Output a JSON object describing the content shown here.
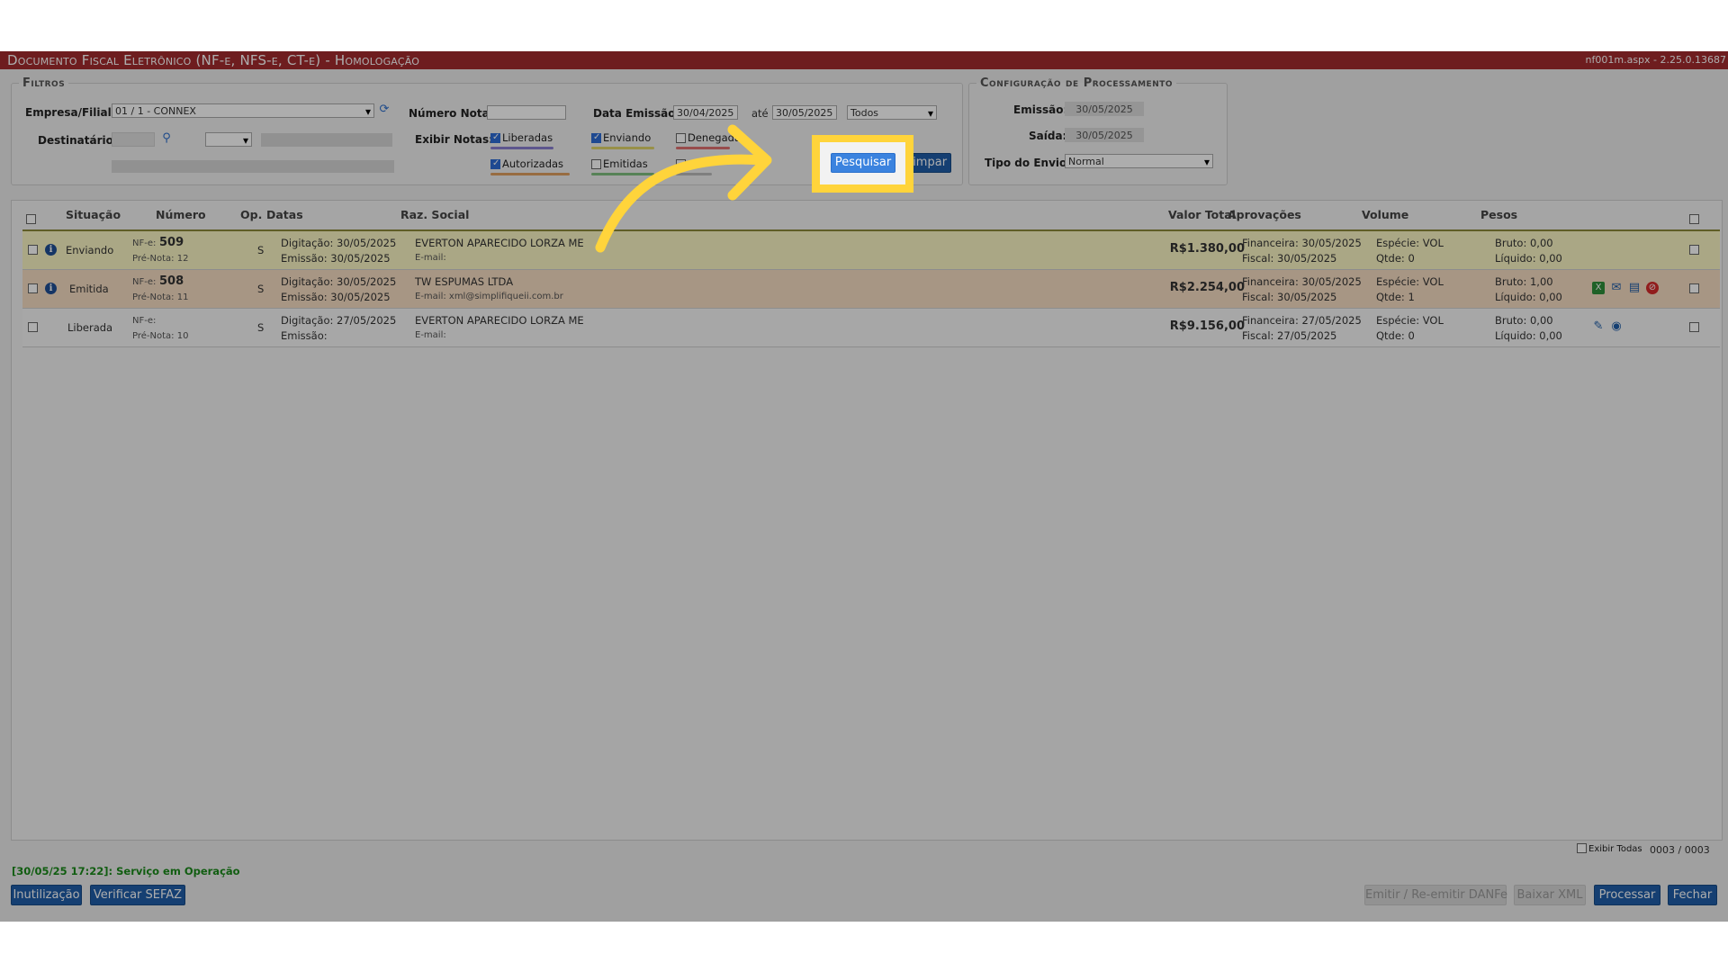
{
  "window": {
    "title": "Documento Fiscal Eletrônico (NF-e, NFS-e, CT-e) - Homologação",
    "version": "nf001m.aspx - 2.25.0.13687"
  },
  "filters": {
    "legend": "Filtros",
    "empresa_label": "Empresa/Filial:",
    "empresa_value": "01 / 1 - CONNEX",
    "destinatario_label": "Destinatário:",
    "numero_nota_label": "Número Nota:",
    "numero_nota_value": "",
    "data_emissao_label": "Data Emissão:",
    "data_de": "30/04/2025",
    "ate_label": "até",
    "data_ate": "30/05/2025",
    "periodo_value": "Todos",
    "exibir_label": "Exibir Notas:",
    "checks": [
      {
        "label": "Liberadas",
        "checked": true,
        "color": "#8a7fd0"
      },
      {
        "label": "Enviando",
        "checked": true,
        "color": "#e0d56a"
      },
      {
        "label": "Denegadas",
        "checked": false,
        "color": "#e07070"
      },
      {
        "label": "Autorizadas",
        "checked": true,
        "color": "#e0a060"
      },
      {
        "label": "Emitidas",
        "checked": false,
        "color": "#80c080"
      },
      {
        "label": "",
        "checked": false,
        "color": "#bbbbbb"
      }
    ],
    "search_button": "Pesquisar",
    "clear_button": "Limpar"
  },
  "config": {
    "legend": "Configuração de Processamento",
    "emissao_label": "Emissão:",
    "emissao_value": "30/05/2025",
    "saida_label": "Saída:",
    "saida_value": "30/05/2025",
    "tipo_label": "Tipo do Envio:",
    "tipo_value": "Normal"
  },
  "table": {
    "headers": [
      "Situação",
      "Número",
      "Op.",
      "Datas",
      "Raz. Social",
      "Valor Total",
      "Aprovações",
      "Volume",
      "Pesos"
    ],
    "rows": [
      {
        "situacao": "Enviando",
        "nfe_label": "NF-e:",
        "nfe": "509",
        "prenota": "Pré-Nota: 12",
        "op": "S",
        "digitacao": "Digitação: 30/05/2025",
        "emissao": "Emissão: 30/05/2025",
        "razao": "EVERTON APARECIDO LORZA ME",
        "email": "E-mail:",
        "valor": "R$1.380,00",
        "financeira": "Financeira: 30/05/2025",
        "fiscal": "Fiscal: 30/05/2025",
        "especie": "Espécie: VOL",
        "qtde": "Qtde: 0",
        "bruto": "Bruto: 0,00",
        "liquido": "Líquido: 0,00",
        "bg": "#fbf6c4"
      },
      {
        "situacao": "Emitida",
        "nfe_label": "NF-e:",
        "nfe": "508",
        "prenota": "Pré-Nota: 11",
        "op": "S",
        "digitacao": "Digitação: 30/05/2025",
        "emissao": "Emissão: 30/05/2025",
        "razao": "TW ESPUMAS LTDA",
        "email": "E-mail: xml@simplifiqueii.com.br",
        "valor": "R$2.254,00",
        "financeira": "Financeira: 30/05/2025",
        "fiscal": "Fiscal: 30/05/2025",
        "especie": "Espécie: VOL",
        "qtde": "Qtde: 1",
        "bruto": "Bruto: 1,00",
        "liquido": "Líquido: 0,00",
        "bg": "#f7ddc3"
      },
      {
        "situacao": "Liberada",
        "nfe_label": "NF-e:",
        "nfe": "",
        "prenota": "Pré-Nota: 10",
        "op": "S",
        "digitacao": "Digitação: 27/05/2025",
        "emissao": "Emissão:",
        "razao": "EVERTON APARECIDO LORZA ME",
        "email": "E-mail:",
        "valor": "R$9.156,00",
        "financeira": "Financeira: 27/05/2025",
        "fiscal": "Fiscal: 27/05/2025",
        "especie": "Espécie: VOL",
        "qtde": "Qtde: 0",
        "bruto": "Bruto: 0,00",
        "liquido": "Líquido: 0,00",
        "bg": "#f6f6f6"
      }
    ],
    "exibir_todas": "Exibir Todas",
    "count": "0003 / 0003"
  },
  "status": "[30/05/25 17:22]: Serviço em Operação",
  "footer": {
    "inutilizacao": "Inutilização",
    "verificar": "Verificar SEFAZ",
    "emitir": "Emitir / Re-emitir DANFe",
    "baixar": "Baixar XML",
    "processar": "Processar",
    "fechar": "Fechar"
  },
  "icons": [
    "refresh-icon",
    "magnifier-icon",
    "info-icon",
    "excel-icon",
    "email-icon",
    "document-icon",
    "cancel-icon",
    "pencil-icon",
    "eye-icon"
  ],
  "colors": {
    "title_bar": "#a32b2f",
    "button": "#1f5ea8",
    "highlight": "#ffd43b",
    "status_text": "#1a8a1a"
  }
}
